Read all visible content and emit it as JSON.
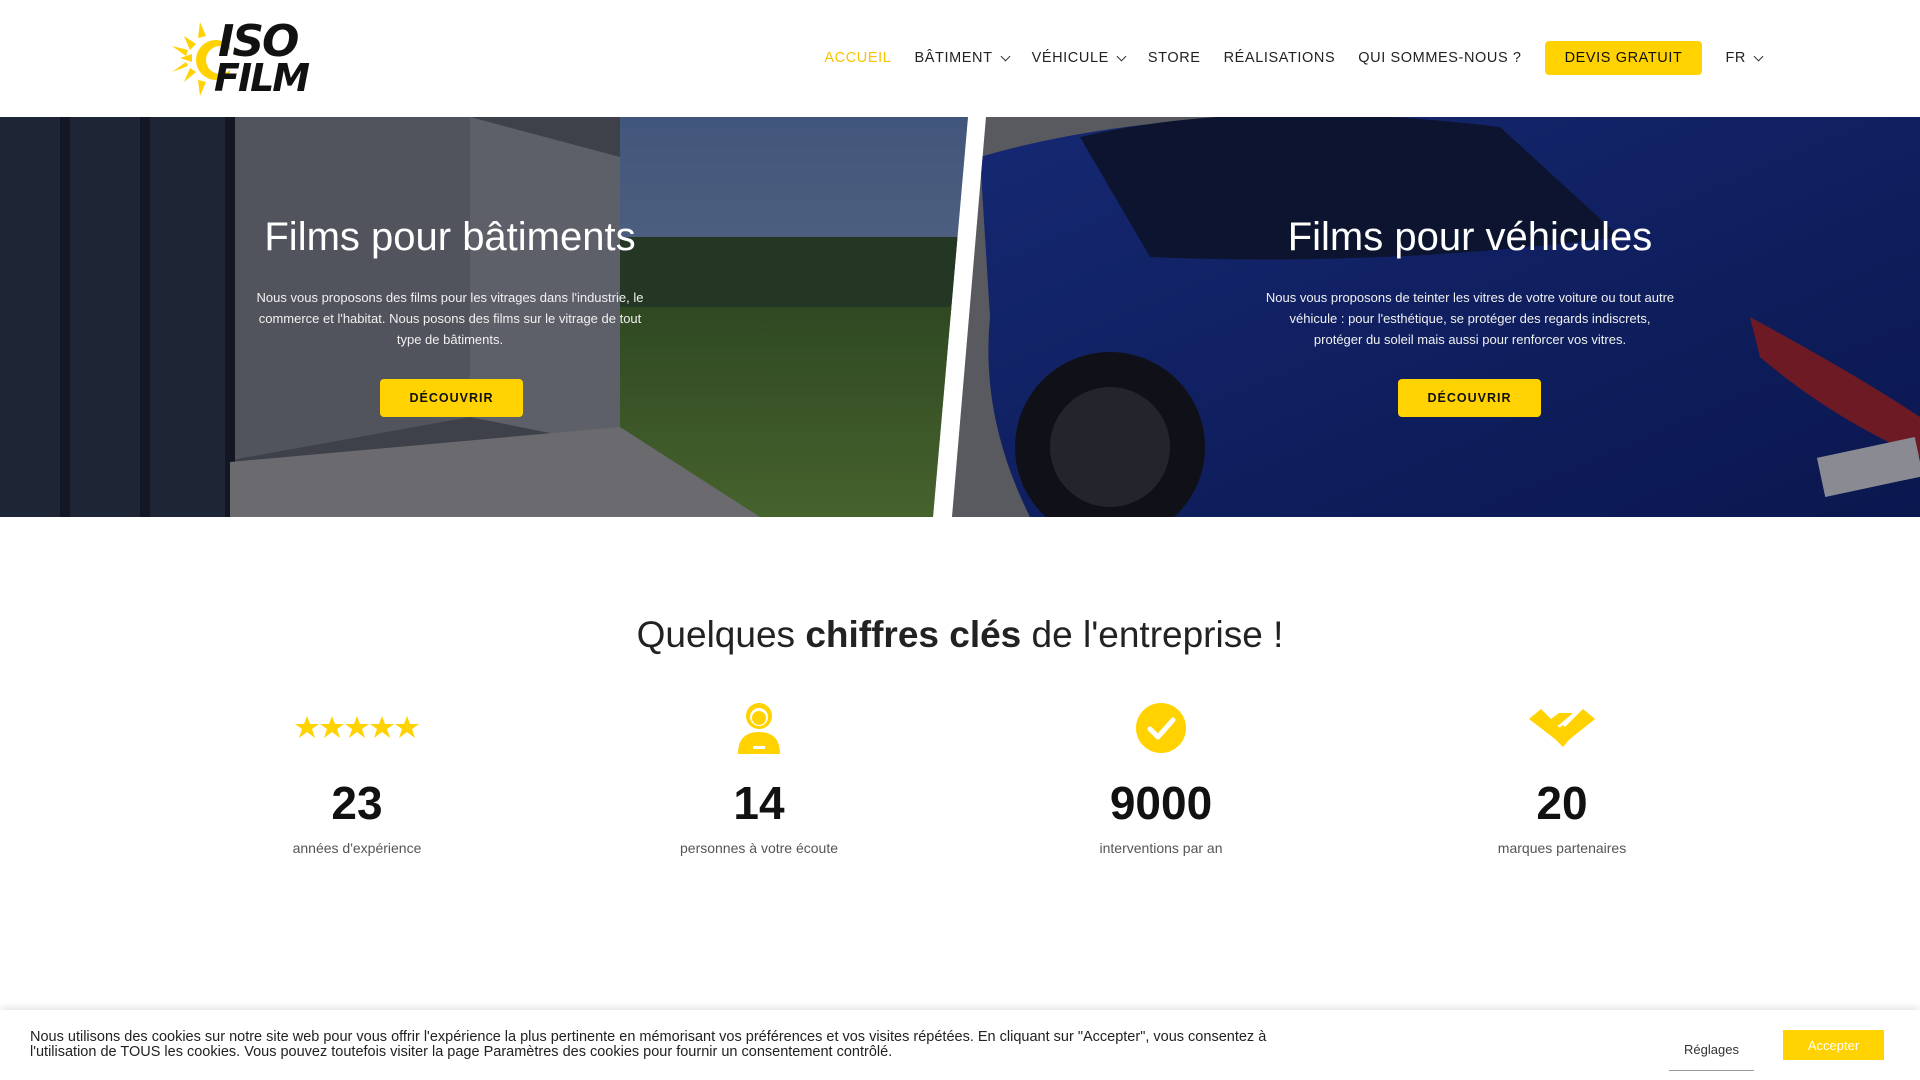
{
  "brand": {
    "name_line1": "ISO",
    "name_line2": "FILM",
    "accent": "#ffd200"
  },
  "nav": {
    "items": [
      {
        "label": "ACCUEIL",
        "active": true
      },
      {
        "label": "BÂTIMENT",
        "dropdown": true
      },
      {
        "label": "VÉHICULE",
        "dropdown": true
      },
      {
        "label": "STORE"
      },
      {
        "label": "RÉALISATIONS"
      },
      {
        "label": "QUI SOMMES-NOUS ?"
      }
    ],
    "cta": "DEVIS GRATUIT",
    "lang": "FR"
  },
  "hero": {
    "left": {
      "title": "Films pour bâtiments",
      "desc": "Nous vous proposons des films pour les vitrages dans l'industrie, le commerce et l'habitat. Nous posons des films sur le vitrage de tout type de bâtiments.",
      "button": "DÉCOUVRIR"
    },
    "right": {
      "title": "Films pour véhicules",
      "desc": "Nous vous proposons de teinter les vitres de votre voiture ou tout autre véhicule : pour l'esthétique, se protéger des regards indiscrets, protéger du soleil mais aussi pour renforcer vos vitres.",
      "button": "DÉCOUVRIR"
    }
  },
  "stats": {
    "title_pre": "Quelques ",
    "title_bold": "chiffres clés",
    "title_post": " de l'entreprise !",
    "items": [
      {
        "icon": "five-stars-icon",
        "value": "23",
        "label": "années d'expérience"
      },
      {
        "icon": "person-icon",
        "value": "14",
        "label": "personnes à votre écoute"
      },
      {
        "icon": "check-circle-icon",
        "value": "9000",
        "label": "interventions par an"
      },
      {
        "icon": "handshake-icon",
        "value": "20",
        "label": "marques partenaires"
      }
    ]
  },
  "cookie": {
    "text": "Nous utilisons des cookies sur notre site web pour vous offrir l'expérience la plus pertinente en mémorisant vos préférences et vos visites répétées. En cliquant sur \"Accepter\", vous consentez à l'utilisation de TOUS les cookies. Vous pouvez toutefois visiter la page Paramètres des cookies pour fournir un consentement contrôlé.",
    "settings": "Réglages",
    "accept": "Accepter"
  }
}
